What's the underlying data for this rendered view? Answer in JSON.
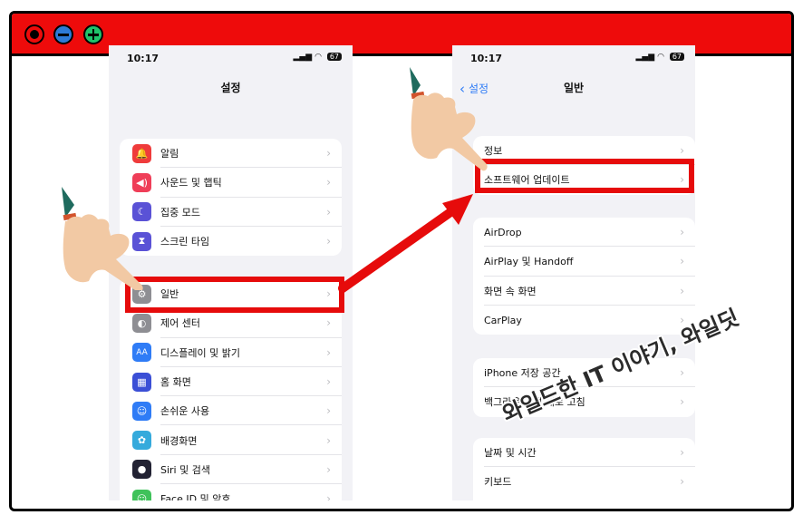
{
  "window": {
    "controls": [
      "close-icon",
      "minimize-icon",
      "maximize-icon"
    ],
    "titlebar_color": "#ee0b0b"
  },
  "left_phone": {
    "time": "10:17",
    "battery": "67",
    "title": "설정",
    "group1": [
      {
        "label": "알림",
        "icon": "bell-icon",
        "color": "#ef3b3b"
      },
      {
        "label": "사운드 및 햅틱",
        "icon": "speaker-icon",
        "color": "#ef3e58"
      },
      {
        "label": "집중 모드",
        "icon": "moon-icon",
        "color": "#5a52d6"
      },
      {
        "label": "스크린 타임",
        "icon": "hourglass-icon",
        "color": "#5a52d6"
      }
    ],
    "group2": [
      {
        "label": "일반",
        "icon": "gear-icon",
        "color": "#8e8e93"
      },
      {
        "label": "제어 센터",
        "icon": "toggles-icon",
        "color": "#8e8e93"
      },
      {
        "label": "디스플레이 및 밝기",
        "icon": "aa-icon",
        "color": "#2f7cf6",
        "glyph": "AA"
      },
      {
        "label": "홈 화면",
        "icon": "grid-icon",
        "color": "#3b4fd6"
      },
      {
        "label": "손쉬운 사용",
        "icon": "accessibility-icon",
        "color": "#2f7cf6"
      },
      {
        "label": "배경화면",
        "icon": "flower-icon",
        "color": "#35aadc"
      },
      {
        "label": "Siri 및 검색",
        "icon": "siri-icon",
        "color": "#222233"
      },
      {
        "label": "Face ID 및 암호",
        "icon": "faceid-icon",
        "color": "#3fc25a"
      }
    ]
  },
  "right_phone": {
    "time": "10:17",
    "battery": "67",
    "back_label": "설정",
    "title": "일반",
    "group1": [
      {
        "label": "정보"
      },
      {
        "label": "소프트웨어 업데이트"
      }
    ],
    "group2": [
      {
        "label": "AirDrop"
      },
      {
        "label": "AirPlay 및 Handoff"
      },
      {
        "label": "화면 속 화면"
      },
      {
        "label": "CarPlay"
      }
    ],
    "group3": [
      {
        "label": "iPhone 저장 공간"
      },
      {
        "label": "백그라운드 앱 새로 고침"
      }
    ],
    "group4": [
      {
        "label": "날짜 및 시간"
      },
      {
        "label": "키보드"
      }
    ]
  },
  "annotations": {
    "highlight_color": "#e60b0b",
    "watermark": "와일드한 IT 이야기, 와일딧"
  }
}
